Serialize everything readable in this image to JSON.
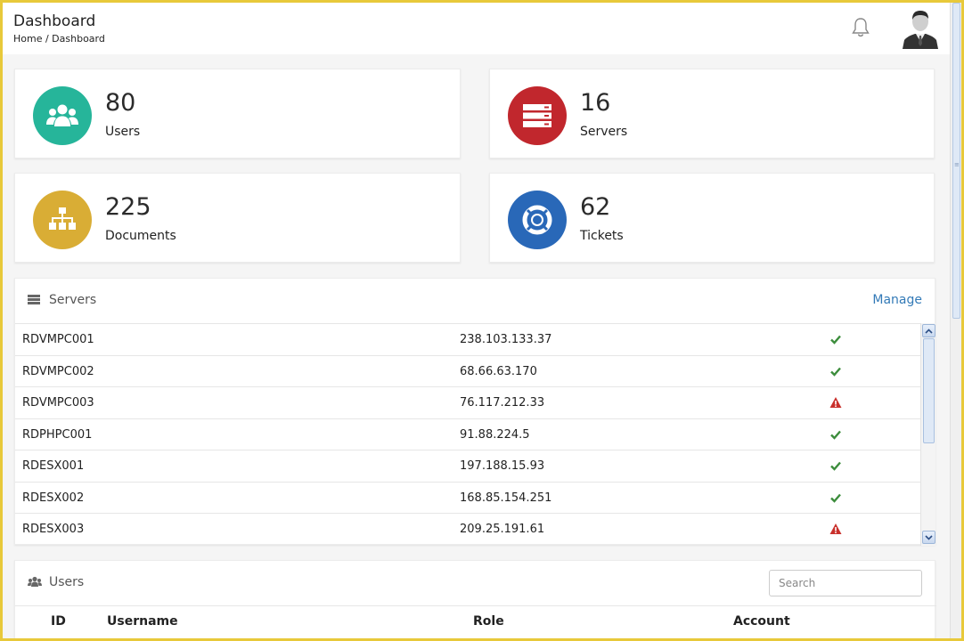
{
  "header": {
    "title": "Dashboard",
    "breadcrumb": "Home / Dashboard",
    "icons": {
      "notifications": "bell-icon",
      "user": "avatar"
    }
  },
  "stats": [
    {
      "value": "80",
      "label": "Users",
      "icon": "users-icon",
      "color": "#26b59a"
    },
    {
      "value": "16",
      "label": "Servers",
      "icon": "server-icon",
      "color": "#c1272d"
    },
    {
      "value": "225",
      "label": "Documents",
      "icon": "sitemap-icon",
      "color": "#d9ad35"
    },
    {
      "value": "62",
      "label": "Tickets",
      "icon": "lifebuoy-icon",
      "color": "#2968b8"
    }
  ],
  "servers_panel": {
    "title": "Servers",
    "manage_label": "Manage",
    "rows": [
      {
        "name": "RDVMPC001",
        "ip": "238.103.133.37",
        "status": "ok"
      },
      {
        "name": "RDVMPC002",
        "ip": "68.66.63.170",
        "status": "ok"
      },
      {
        "name": "RDVMPC003",
        "ip": "76.117.212.33",
        "status": "warning"
      },
      {
        "name": "RDPHPC001",
        "ip": "91.88.224.5",
        "status": "ok"
      },
      {
        "name": "RDESX001",
        "ip": "197.188.15.93",
        "status": "ok"
      },
      {
        "name": "RDESX002",
        "ip": "168.85.154.251",
        "status": "ok"
      },
      {
        "name": "RDESX003",
        "ip": "209.25.191.61",
        "status": "warning"
      }
    ]
  },
  "users_panel": {
    "title": "Users",
    "search_placeholder": "Search",
    "columns": [
      "ID",
      "Username",
      "Role",
      "Account"
    ]
  },
  "colors": {
    "ok": "#3c8d3c",
    "warning": "#c9302c",
    "link": "#337ab7"
  }
}
